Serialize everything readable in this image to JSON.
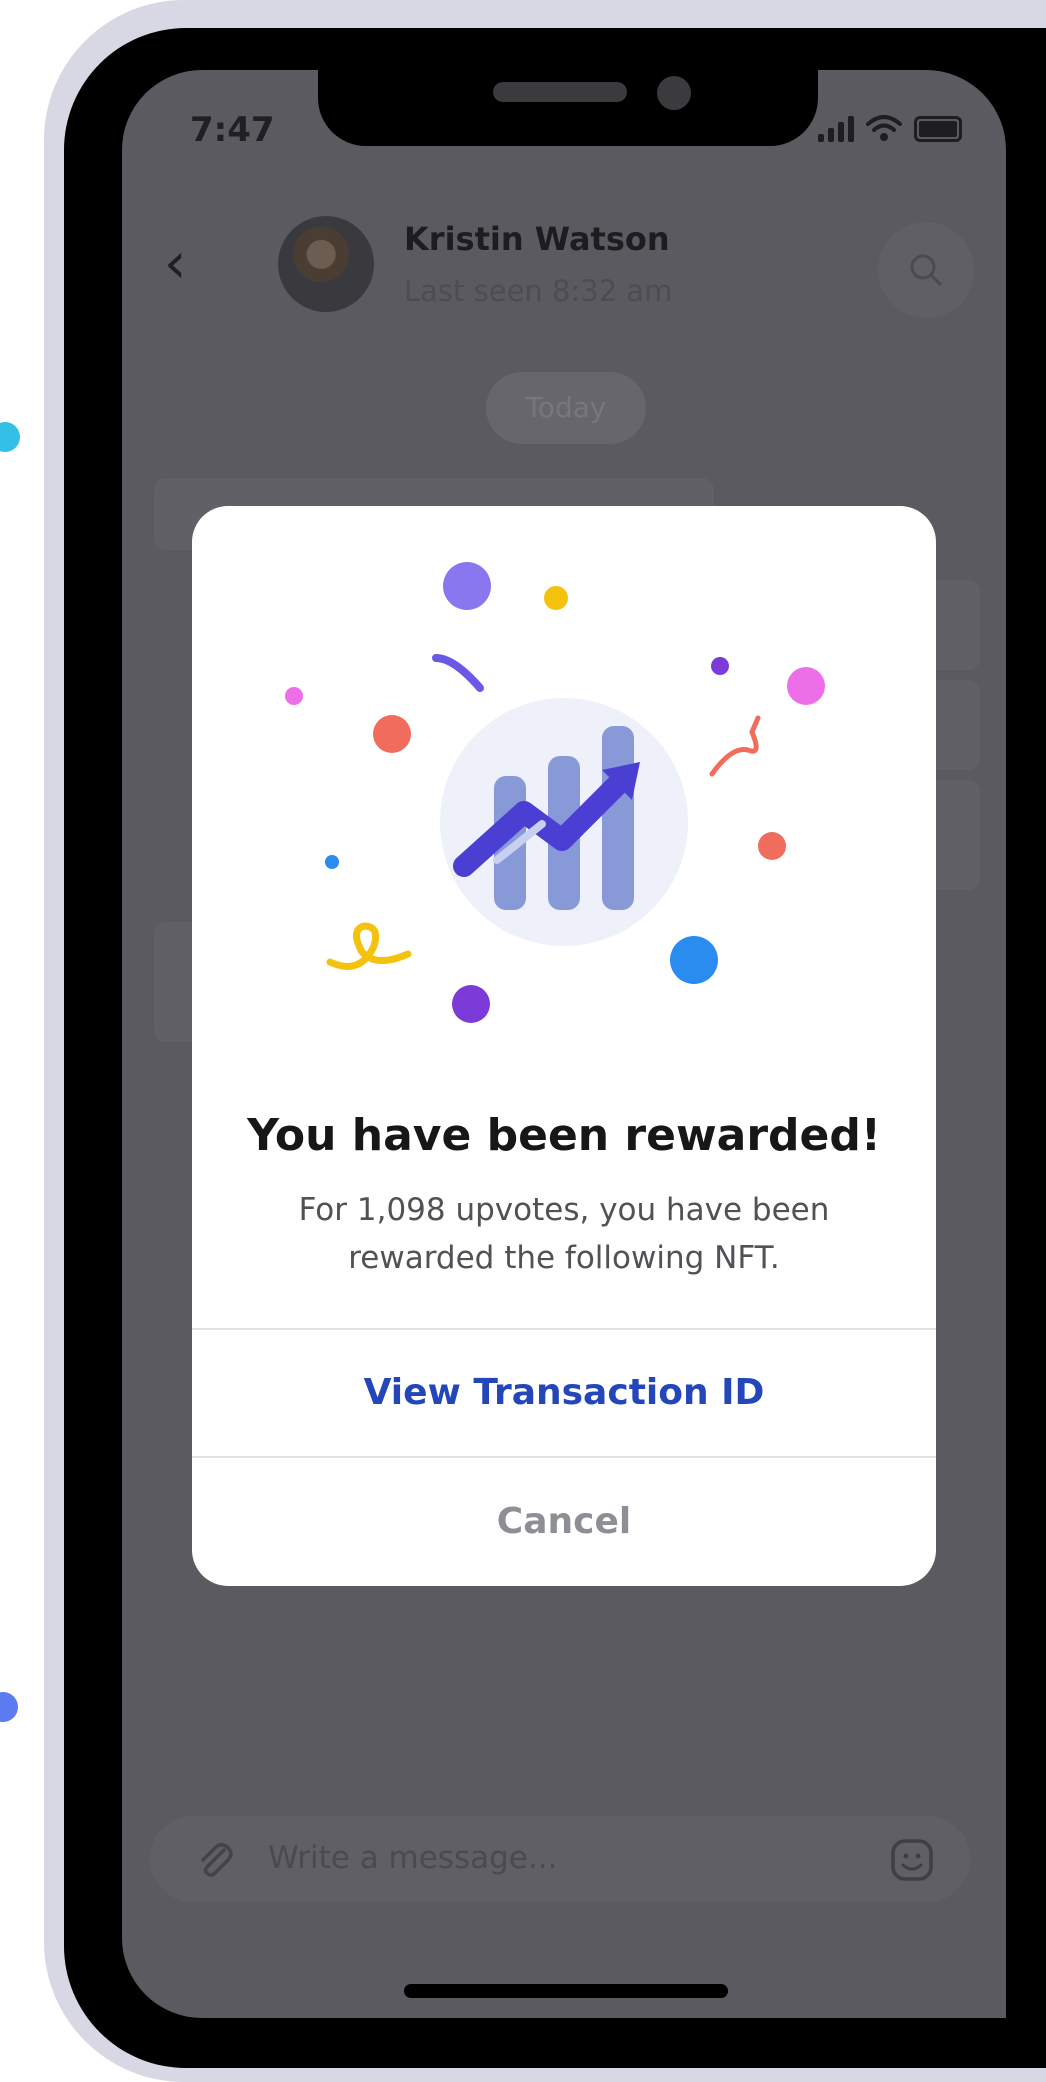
{
  "status_bar": {
    "time": "7:47"
  },
  "chat_header": {
    "name": "Kristin Watson",
    "last_seen": "Last seen 8:32 am"
  },
  "date_separator": "Today",
  "composer": {
    "placeholder": "Write a message..."
  },
  "modal": {
    "title": "You have been rewarded!",
    "body": "For 1,098 upvotes, you have been rewarded the following NFT.",
    "primary_action": "View Transaction ID",
    "secondary_action": "Cancel"
  },
  "colors": {
    "accent": "#2346b8",
    "chart_bar": "#8899d8",
    "arrow": "#4b3fd3",
    "overlay": "#5a5a60"
  },
  "icons": [
    "back-chevron-icon",
    "search-icon",
    "signal-icon",
    "wifi-icon",
    "battery-icon",
    "attachment-icon",
    "emoji-icon",
    "growth-chart-icon"
  ]
}
